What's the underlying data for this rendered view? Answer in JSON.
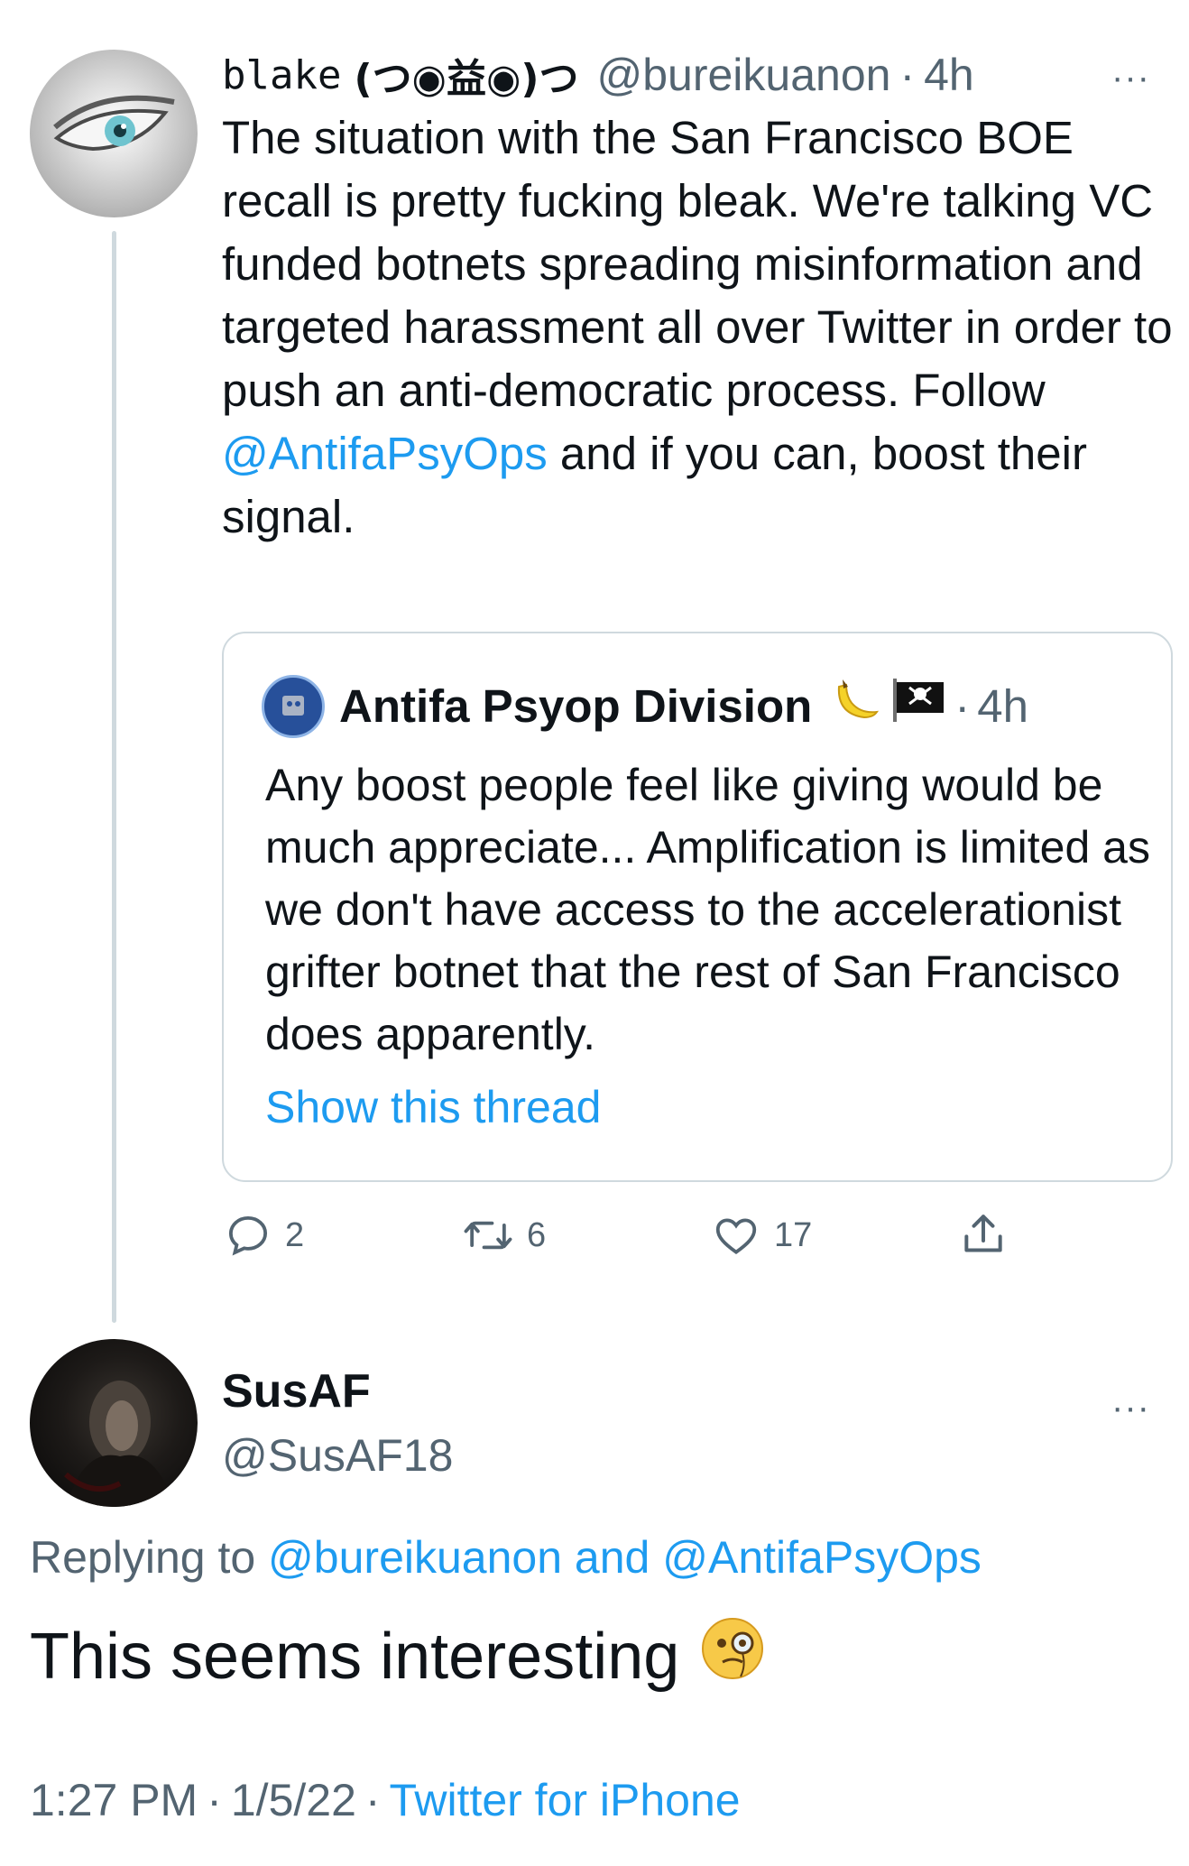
{
  "main_tweet": {
    "name": "blake",
    "name_kaomoji": "(つ◉益◉)つ",
    "handle": "@bureikuanon",
    "separator": "·",
    "time": "4h",
    "more": "···",
    "text_before_mention": "The situation with the San Francisco BOE recall is pretty fucking bleak. We're talking VC funded botnets spreading misinformation and targeted harassment all over Twitter in order to push an anti-democratic process. Follow ",
    "mention": "@AntifaPsyOps",
    "text_after_mention": " and if you can, boost their signal."
  },
  "quote_tweet": {
    "name": "Antifa Psyop Division",
    "name_emojis": [
      "banana-emoji",
      "pirate-flag-emoji"
    ],
    "separator": "·",
    "time": "4h",
    "text": "Any boost people feel like giving would be much appreciate... Amplification is limited as we don't have access to the accelerationist grifter botnet that the rest of San Francisco does apparently.",
    "show_thread": "Show this thread"
  },
  "actions": {
    "replies": "2",
    "retweets": "6",
    "likes": "17"
  },
  "reply_tweet": {
    "name": "SusAF",
    "handle": "@SusAF18",
    "more": "···",
    "replying_prefix": "Replying to ",
    "replying_to_1": "@bureikuanon",
    "replying_and": " and ",
    "replying_to_2": "@AntifaPsyOps",
    "text": "This seems interesting",
    "emoji": "face-with-monocle-emoji",
    "time": "1:27 PM",
    "separator": "·",
    "date": "1/5/22",
    "source": "Twitter for iPhone"
  },
  "colors": {
    "link": "#1d9bf0",
    "secondary_text": "#536471",
    "primary_text": "#0f1419",
    "border": "#cfd9de"
  }
}
